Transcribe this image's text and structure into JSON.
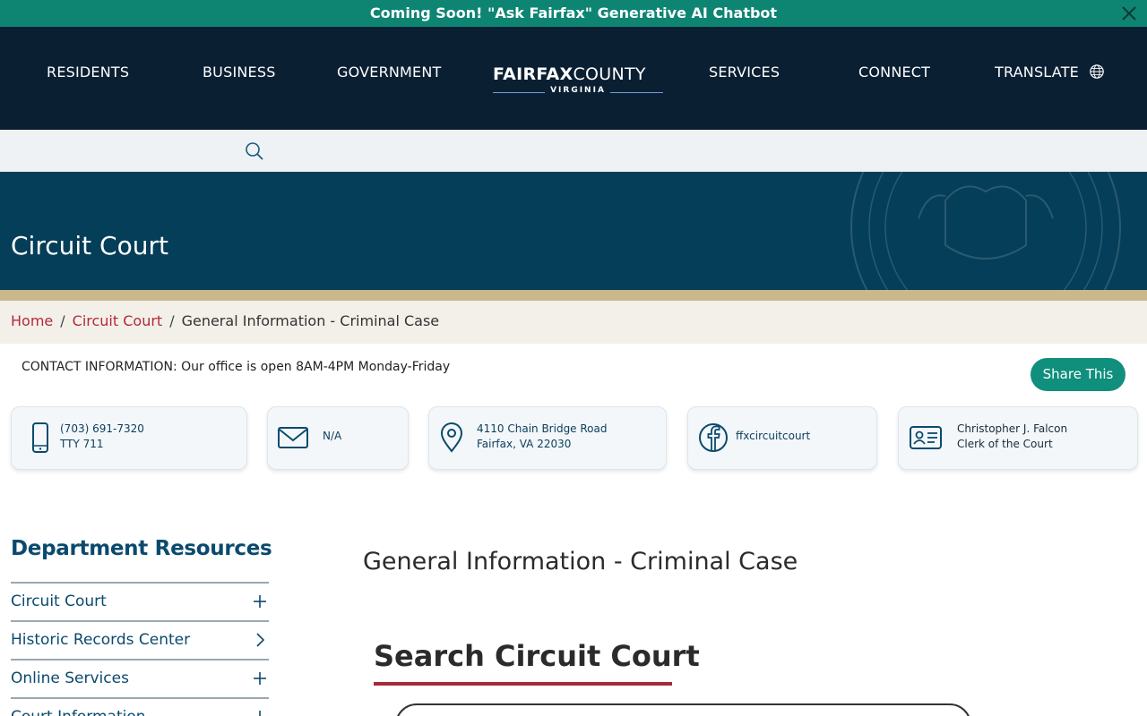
{
  "announcement": {
    "text": "Coming Soon! \"Ask Fairfax\" Generative AI Chatbot"
  },
  "nav": {
    "residents": "RESIDENTS",
    "business": "BUSINESS",
    "government": "GOVERNMENT",
    "services": "SERVICES",
    "connect": "CONNECT",
    "translate": "TRANSLATE"
  },
  "logo": {
    "bold": "FAIRFAX",
    "light": "COUNTY",
    "sub": "VIRGINIA"
  },
  "hero": {
    "title": "Circuit Court"
  },
  "breadcrumb": {
    "home": "Home",
    "section": "Circuit Court",
    "current": "General Information - Criminal Case"
  },
  "contact": {
    "info": "CONTACT INFORMATION: Our office is open 8AM-4PM Monday-Friday",
    "share_label": "Share This",
    "phone": {
      "line1": "(703) 691-7320",
      "line2": "TTY 711"
    },
    "email": {
      "line1": "N/A"
    },
    "address": {
      "line1": "4110 Chain Bridge Road",
      "line2": "Fairfax, VA 22030"
    },
    "social": {
      "line1": "ffxcircuitcourt"
    },
    "person": {
      "line1": "Christopher J. Falcon",
      "line2": "Clerk of the Court"
    }
  },
  "sidebar": {
    "title": "Department Resources",
    "items": [
      {
        "label": "Circuit Court",
        "toggle": "plus-icon"
      },
      {
        "label": "Historic Records Center",
        "toggle": "chevron-right-icon"
      },
      {
        "label": "Online Services",
        "toggle": "plus-icon"
      },
      {
        "label": "Court Information",
        "toggle": "plus-icon"
      }
    ]
  },
  "main": {
    "heading": "General Information - Criminal Case",
    "search_section_title": "Search Circuit Court"
  },
  "colors": {
    "banner": "#0e8573",
    "nav_bg": "#0b1f33",
    "hero_bg": "#053e58",
    "gold": "#c9b88a",
    "link_red": "#b32a38",
    "accent_green": "#0f8f7c",
    "sidebar_blue": "#0b4a6e"
  }
}
